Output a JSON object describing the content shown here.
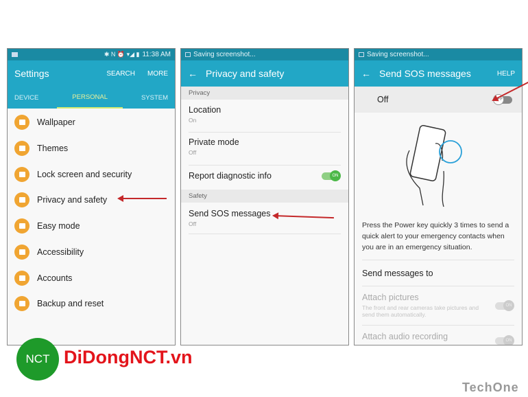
{
  "panel1": {
    "status_time": "11:38 AM",
    "title": "Settings",
    "actions": [
      "SEARCH",
      "MORE"
    ],
    "tabs": [
      "DEVICE",
      "PERSONAL",
      "SYSTEM"
    ],
    "selected_tab": "PERSONAL",
    "items": [
      {
        "label": "Wallpaper",
        "icon": "wallpaper-icon"
      },
      {
        "label": "Themes",
        "icon": "themes-icon"
      },
      {
        "label": "Lock screen and security",
        "icon": "lock-icon"
      },
      {
        "label": "Privacy and safety",
        "icon": "privacy-icon"
      },
      {
        "label": "Easy mode",
        "icon": "home-icon"
      },
      {
        "label": "Accessibility",
        "icon": "hand-icon"
      },
      {
        "label": "Accounts",
        "icon": "key-icon"
      },
      {
        "label": "Backup and reset",
        "icon": "backup-icon"
      }
    ]
  },
  "panel2": {
    "status": "Saving screenshot...",
    "title": "Privacy and safety",
    "sections": {
      "privacy": "Privacy",
      "safety": "Safety"
    },
    "location": {
      "title": "Location",
      "sub": "On"
    },
    "private_mode": {
      "title": "Private mode",
      "sub": "Off"
    },
    "report": {
      "title": "Report diagnostic info",
      "toggle": "ON"
    },
    "sos": {
      "title": "Send SOS messages",
      "sub": "Off"
    }
  },
  "panel3": {
    "status": "Saving screenshot...",
    "title": "Send SOS messages",
    "help": "HELP",
    "master": {
      "label": "Off",
      "toggle": "OFF"
    },
    "description": "Press the Power key quickly 3 times to send a quick alert to your emergency contacts when you are in an emergency situation.",
    "send_to": "Send messages to",
    "attach_pictures": {
      "title": "Attach pictures",
      "sub": "The front and rear cameras take pictures and send them automatically.",
      "toggle": "ON"
    },
    "attach_audio": {
      "title": "Attach audio recording",
      "toggle": "ON"
    }
  },
  "logos": {
    "left": "DiDongNCT.vn",
    "left_badge": "NCT",
    "right": "TechOne"
  },
  "colors": {
    "header": "#22a7c6",
    "accent_orange": "#f0a532",
    "toggle_on": "#4cb848",
    "arrow": "#c4282a"
  }
}
